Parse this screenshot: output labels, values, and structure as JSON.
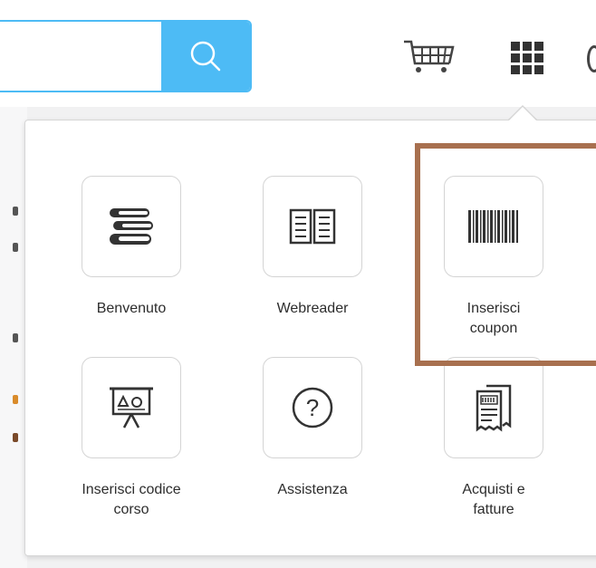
{
  "header": {
    "search": {
      "value": "",
      "placeholder": ""
    },
    "icons": {
      "search": "search-icon",
      "cart": "cart-icon",
      "apps": "apps-grid-icon"
    }
  },
  "menu": {
    "items": [
      {
        "label": "Benvenuto",
        "icon": "books-icon"
      },
      {
        "label": "Webreader",
        "icon": "open-book-icon"
      },
      {
        "label": "Inserisci\ncoupon",
        "icon": "barcode-icon"
      },
      {
        "label": "Inserisci codice\ncorso",
        "icon": "presentation-board-icon"
      },
      {
        "label": "Assistenza",
        "icon": "help-circle-icon"
      },
      {
        "label": "Acquisti e\nfatture",
        "icon": "receipts-icon"
      }
    ]
  },
  "colors": {
    "search_accent": "#4dbbf5",
    "highlight_border": "#a8704f",
    "icon_dark": "#333333"
  }
}
